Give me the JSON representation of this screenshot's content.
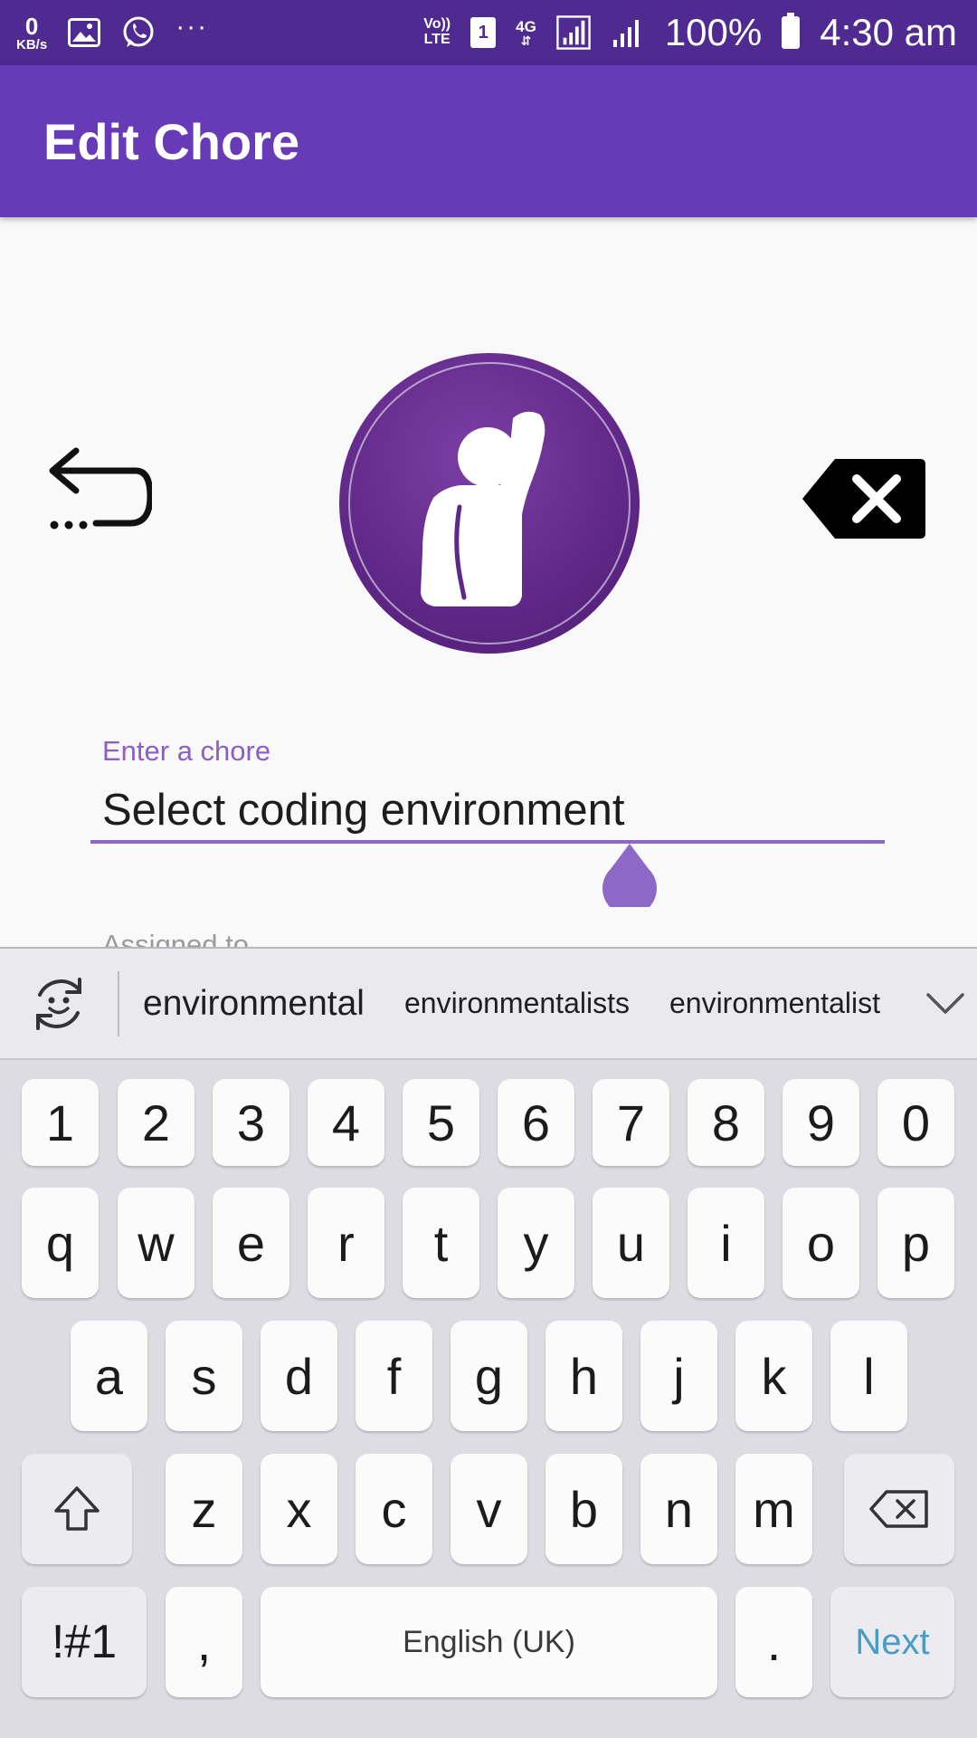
{
  "status_bar": {
    "speed_value": "0",
    "speed_unit": "KB/s",
    "volte_line1": "Vo))",
    "volte_line2": "LTE",
    "sim_slot": "1",
    "network": "4G",
    "battery_percent": "100%",
    "time": "4:30 am",
    "more_dots": "···"
  },
  "app_bar": {
    "title": "Edit Chore"
  },
  "form": {
    "chore_label": "Enter a chore",
    "chore_value": "Select coding environment",
    "assigned_label": "Assigned to"
  },
  "suggestions": {
    "items": [
      "environmental",
      "environmentalists",
      "environmentalist"
    ]
  },
  "keyboard": {
    "number_row": [
      "1",
      "2",
      "3",
      "4",
      "5",
      "6",
      "7",
      "8",
      "9",
      "0"
    ],
    "row1": [
      "q",
      "w",
      "e",
      "r",
      "t",
      "y",
      "u",
      "i",
      "o",
      "p"
    ],
    "row2": [
      "a",
      "s",
      "d",
      "f",
      "g",
      "h",
      "j",
      "k",
      "l"
    ],
    "row3": [
      "z",
      "x",
      "c",
      "v",
      "b",
      "n",
      "m"
    ],
    "symbols_key": "!#1",
    "comma_key": ",",
    "space_label": "English (UK)",
    "period_key": ".",
    "action_key": "Next"
  },
  "colors": {
    "status_bar": "#4e2a91",
    "app_bar": "#673ab7",
    "accent": "#8b5fc4",
    "avatar": "#5f2787",
    "next_key": "#4a9cc8"
  },
  "icons": {
    "undo": "undo-icon",
    "clear": "backspace-clear-icon",
    "avatar": "person-waving-icon",
    "emoji": "emoji-sync-icon",
    "expand": "chevron-down-icon",
    "shift": "shift-icon",
    "delete": "backspace-icon"
  }
}
